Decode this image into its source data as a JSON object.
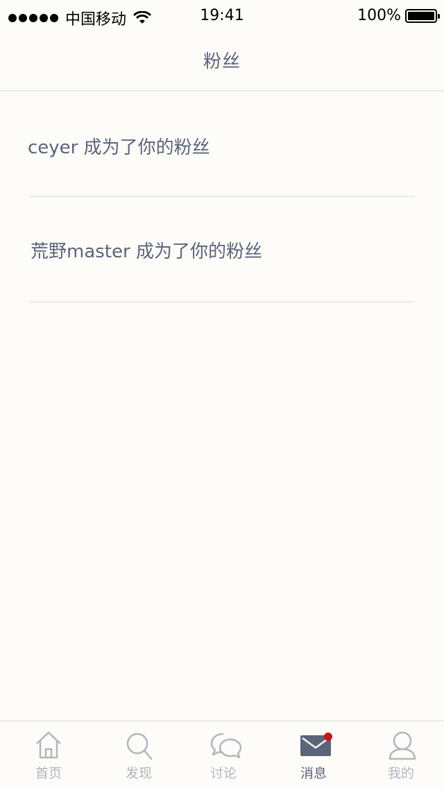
{
  "status_bar": {
    "carrier": "中国移动",
    "time": "19:41",
    "battery": "100%"
  },
  "nav": {
    "title": "粉丝"
  },
  "notifications": [
    {
      "text": "ceyer 成为了你的粉丝"
    },
    {
      "text": "荒野master 成为了你的粉丝"
    }
  ],
  "tabs": [
    {
      "label": "首页",
      "icon": "home-icon",
      "active": false
    },
    {
      "label": "发现",
      "icon": "search-icon",
      "active": false
    },
    {
      "label": "讨论",
      "icon": "chat-icon",
      "active": false
    },
    {
      "label": "消息",
      "icon": "mail-icon",
      "active": true
    },
    {
      "label": "我的",
      "icon": "user-icon",
      "active": false
    }
  ],
  "colors": {
    "background": "#fdfcf9",
    "text": "#5b6479",
    "inactive": "#b2b5bd",
    "badge": "#c4161c"
  }
}
